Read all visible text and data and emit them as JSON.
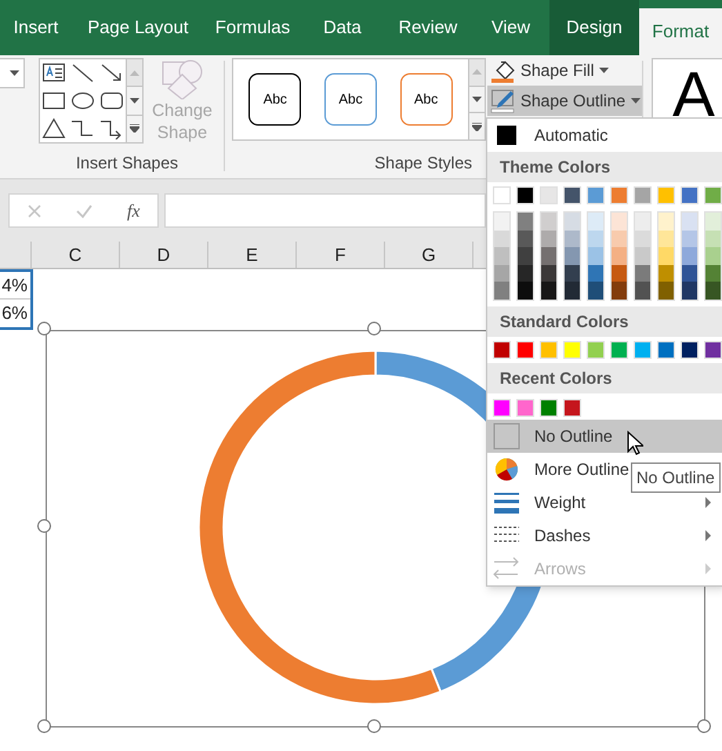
{
  "tabs": [
    {
      "label": "Insert",
      "selected": false,
      "kind": "tab"
    },
    {
      "label": "Page Layout",
      "selected": false,
      "kind": "tab"
    },
    {
      "label": "Formulas",
      "selected": false,
      "kind": "tab"
    },
    {
      "label": "Data",
      "selected": false,
      "kind": "tab"
    },
    {
      "label": "Review",
      "selected": false,
      "kind": "tab"
    },
    {
      "label": "View",
      "selected": false,
      "kind": "tab"
    },
    {
      "label": "Design",
      "selected": false,
      "kind": "context"
    },
    {
      "label": "Format",
      "selected": true,
      "kind": "context"
    }
  ],
  "ribbon": {
    "insert_shapes_label": "Insert Shapes",
    "change_shape": {
      "label": "Change Shape",
      "disabled": true
    },
    "style_presets": [
      {
        "label": "Abc",
        "color": "#000000"
      },
      {
        "label": "Abc",
        "color": "#5b9bd5"
      },
      {
        "label": "Abc",
        "color": "#ed7d31"
      }
    ],
    "shape_styles_label": "Shape Styles",
    "shape_fill": {
      "label": "Shape Fill",
      "expanded": false
    },
    "shape_outline": {
      "label": "Shape Outline",
      "expanded": true
    },
    "wordart_preview": "A"
  },
  "formula_bar": {
    "function_button": "fx"
  },
  "columns": [
    "C",
    "D",
    "E",
    "F",
    "G"
  ],
  "cells": [
    "4%",
    "6%"
  ],
  "outline_menu": {
    "automatic": {
      "label": "Automatic",
      "color": "#000000"
    },
    "theme_header": "Theme Colors",
    "theme_colors": [
      {
        "color": "#ffffff",
        "shades": [
          {
            "color": "#f2f2f2"
          },
          {
            "color": "#d9d9d9"
          },
          {
            "color": "#bfbfbf"
          },
          {
            "color": "#a6a6a6"
          },
          {
            "color": "#808080"
          }
        ]
      },
      {
        "color": "#000000",
        "shades": [
          {
            "color": "#808080"
          },
          {
            "color": "#595959"
          },
          {
            "color": "#404040"
          },
          {
            "color": "#262626"
          },
          {
            "color": "#0d0d0d"
          }
        ]
      },
      {
        "color": "#e7e6e6",
        "shades": [
          {
            "color": "#d0cece"
          },
          {
            "color": "#aeabab"
          },
          {
            "color": "#757070"
          },
          {
            "color": "#3b3838"
          },
          {
            "color": "#181717"
          }
        ]
      },
      {
        "color": "#44546a",
        "shades": [
          {
            "color": "#d6dce4"
          },
          {
            "color": "#adb9ca"
          },
          {
            "color": "#8497b0"
          },
          {
            "color": "#333f4f"
          },
          {
            "color": "#222a35"
          }
        ]
      },
      {
        "color": "#5b9bd5",
        "shades": [
          {
            "color": "#ddebf7"
          },
          {
            "color": "#bdd7ee"
          },
          {
            "color": "#9bc2e6"
          },
          {
            "color": "#2f75b5"
          },
          {
            "color": "#1f4e78"
          }
        ]
      },
      {
        "color": "#ed7d31",
        "shades": [
          {
            "color": "#fce4d6"
          },
          {
            "color": "#f8cbad"
          },
          {
            "color": "#f4b084"
          },
          {
            "color": "#c65911"
          },
          {
            "color": "#833c0c"
          }
        ]
      },
      {
        "color": "#a5a5a5",
        "shades": [
          {
            "color": "#ededed"
          },
          {
            "color": "#dbdbdb"
          },
          {
            "color": "#c9c9c9"
          },
          {
            "color": "#7b7b7b"
          },
          {
            "color": "#525252"
          }
        ]
      },
      {
        "color": "#ffc000",
        "shades": [
          {
            "color": "#fff2cc"
          },
          {
            "color": "#ffe699"
          },
          {
            "color": "#ffd966"
          },
          {
            "color": "#bf8f00"
          },
          {
            "color": "#806000"
          }
        ]
      },
      {
        "color": "#4472c4",
        "shades": [
          {
            "color": "#d9e1f2"
          },
          {
            "color": "#b4c6e7"
          },
          {
            "color": "#8ea9db"
          },
          {
            "color": "#305496"
          },
          {
            "color": "#203764"
          }
        ]
      },
      {
        "color": "#70ad47",
        "shades": [
          {
            "color": "#e2efda"
          },
          {
            "color": "#c6e0b4"
          },
          {
            "color": "#a9d08e"
          },
          {
            "color": "#548235"
          },
          {
            "color": "#375623"
          }
        ]
      }
    ],
    "standard_header": "Standard Colors",
    "standard_colors": [
      {
        "color": "#c00000"
      },
      {
        "color": "#ff0000"
      },
      {
        "color": "#ffc000"
      },
      {
        "color": "#ffff00"
      },
      {
        "color": "#92d050"
      },
      {
        "color": "#00b050"
      },
      {
        "color": "#00b0f0"
      },
      {
        "color": "#0070c0"
      },
      {
        "color": "#002060"
      },
      {
        "color": "#7030a0"
      }
    ],
    "recent_header": "Recent Colors",
    "recent_colors": [
      {
        "color": "#ff00ff"
      },
      {
        "color": "#ff66cc"
      },
      {
        "color": "#008000"
      },
      {
        "color": "#c5161d"
      }
    ],
    "items": [
      {
        "kind": "no-outline",
        "label": "No Outline",
        "highlighted": true,
        "disabled": false
      },
      {
        "kind": "more-colors",
        "label": "More Outline",
        "highlighted": false,
        "disabled": false
      },
      {
        "kind": "weight",
        "label": "Weight",
        "highlighted": false,
        "disabled": false
      },
      {
        "kind": "dashes",
        "label": "Dashes",
        "highlighted": false,
        "disabled": false
      },
      {
        "kind": "arrows",
        "label": "Arrows",
        "highlighted": false,
        "disabled": true
      }
    ]
  },
  "tooltip": "No Outline"
}
